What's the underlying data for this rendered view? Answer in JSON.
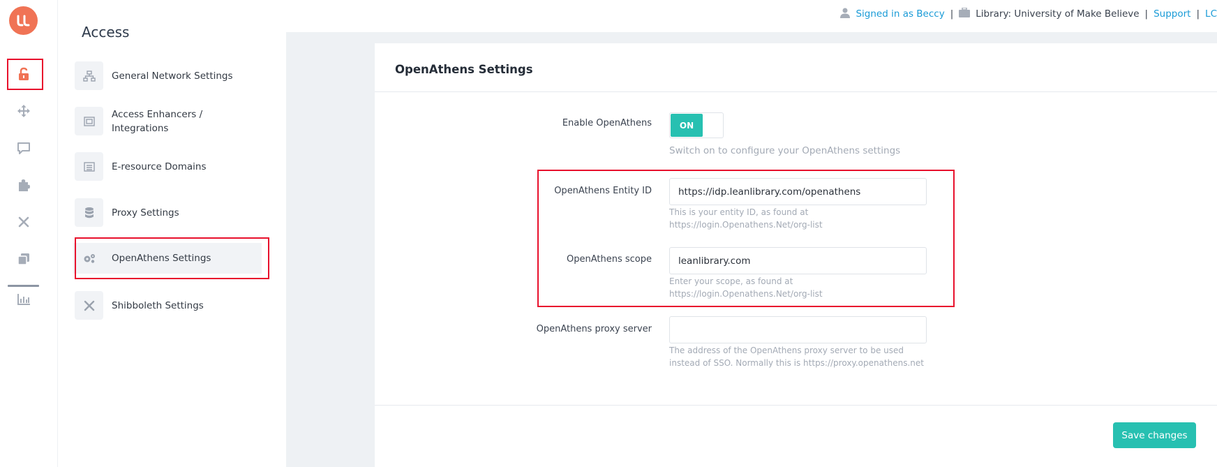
{
  "header": {
    "signed_in": "Signed in as Beccy",
    "library": "Library: University of Make Believe",
    "support": "Support",
    "logout_partial": "LC",
    "separator": "|"
  },
  "rail": {
    "logo_text": "LL",
    "icons": [
      "unlock-icon",
      "move-arrows-icon",
      "chat-icon",
      "puzzle-icon",
      "tools-icon",
      "copy-icon",
      "bar-chart-icon"
    ]
  },
  "nav": {
    "title": "Access",
    "items": [
      {
        "label": "General Network Settings",
        "icon": "network-icon"
      },
      {
        "label": "Access Enhancers / Integrations",
        "icon": "screen-icon"
      },
      {
        "label": "E-resource Domains",
        "icon": "list-icon"
      },
      {
        "label": "Proxy Settings",
        "icon": "database-icon"
      },
      {
        "label": "OpenAthens Settings",
        "icon": "gears-icon"
      },
      {
        "label": "Shibboleth Settings",
        "icon": "tools-icon"
      }
    ]
  },
  "card": {
    "title": "OpenAthens Settings",
    "enable_label": "Enable OpenAthens",
    "toggle_on": "ON",
    "enable_help": "Switch on to configure your OpenAthens settings",
    "entity_label": "OpenAthens Entity ID",
    "entity_value": "https://idp.leanlibrary.com/openathens",
    "entity_help": "This is your entity ID, as found at https://login.Openathens.Net/org-list",
    "scope_label": "OpenAthens scope",
    "scope_value": "leanlibrary.com",
    "scope_help": "Enter your scope, as found at https://login.Openathens.Net/org-list",
    "proxy_label": "OpenAthens proxy server",
    "proxy_value": "",
    "proxy_help": "The address of the OpenAthens proxy server to be used instead of SSO. Normally this is https://proxy.openathens.net",
    "save_label": "Save changes"
  },
  "colors": {
    "accent": "#27c0b1",
    "brand": "#f07355",
    "link": "#1a9bd7",
    "highlight": "#e8112d"
  }
}
